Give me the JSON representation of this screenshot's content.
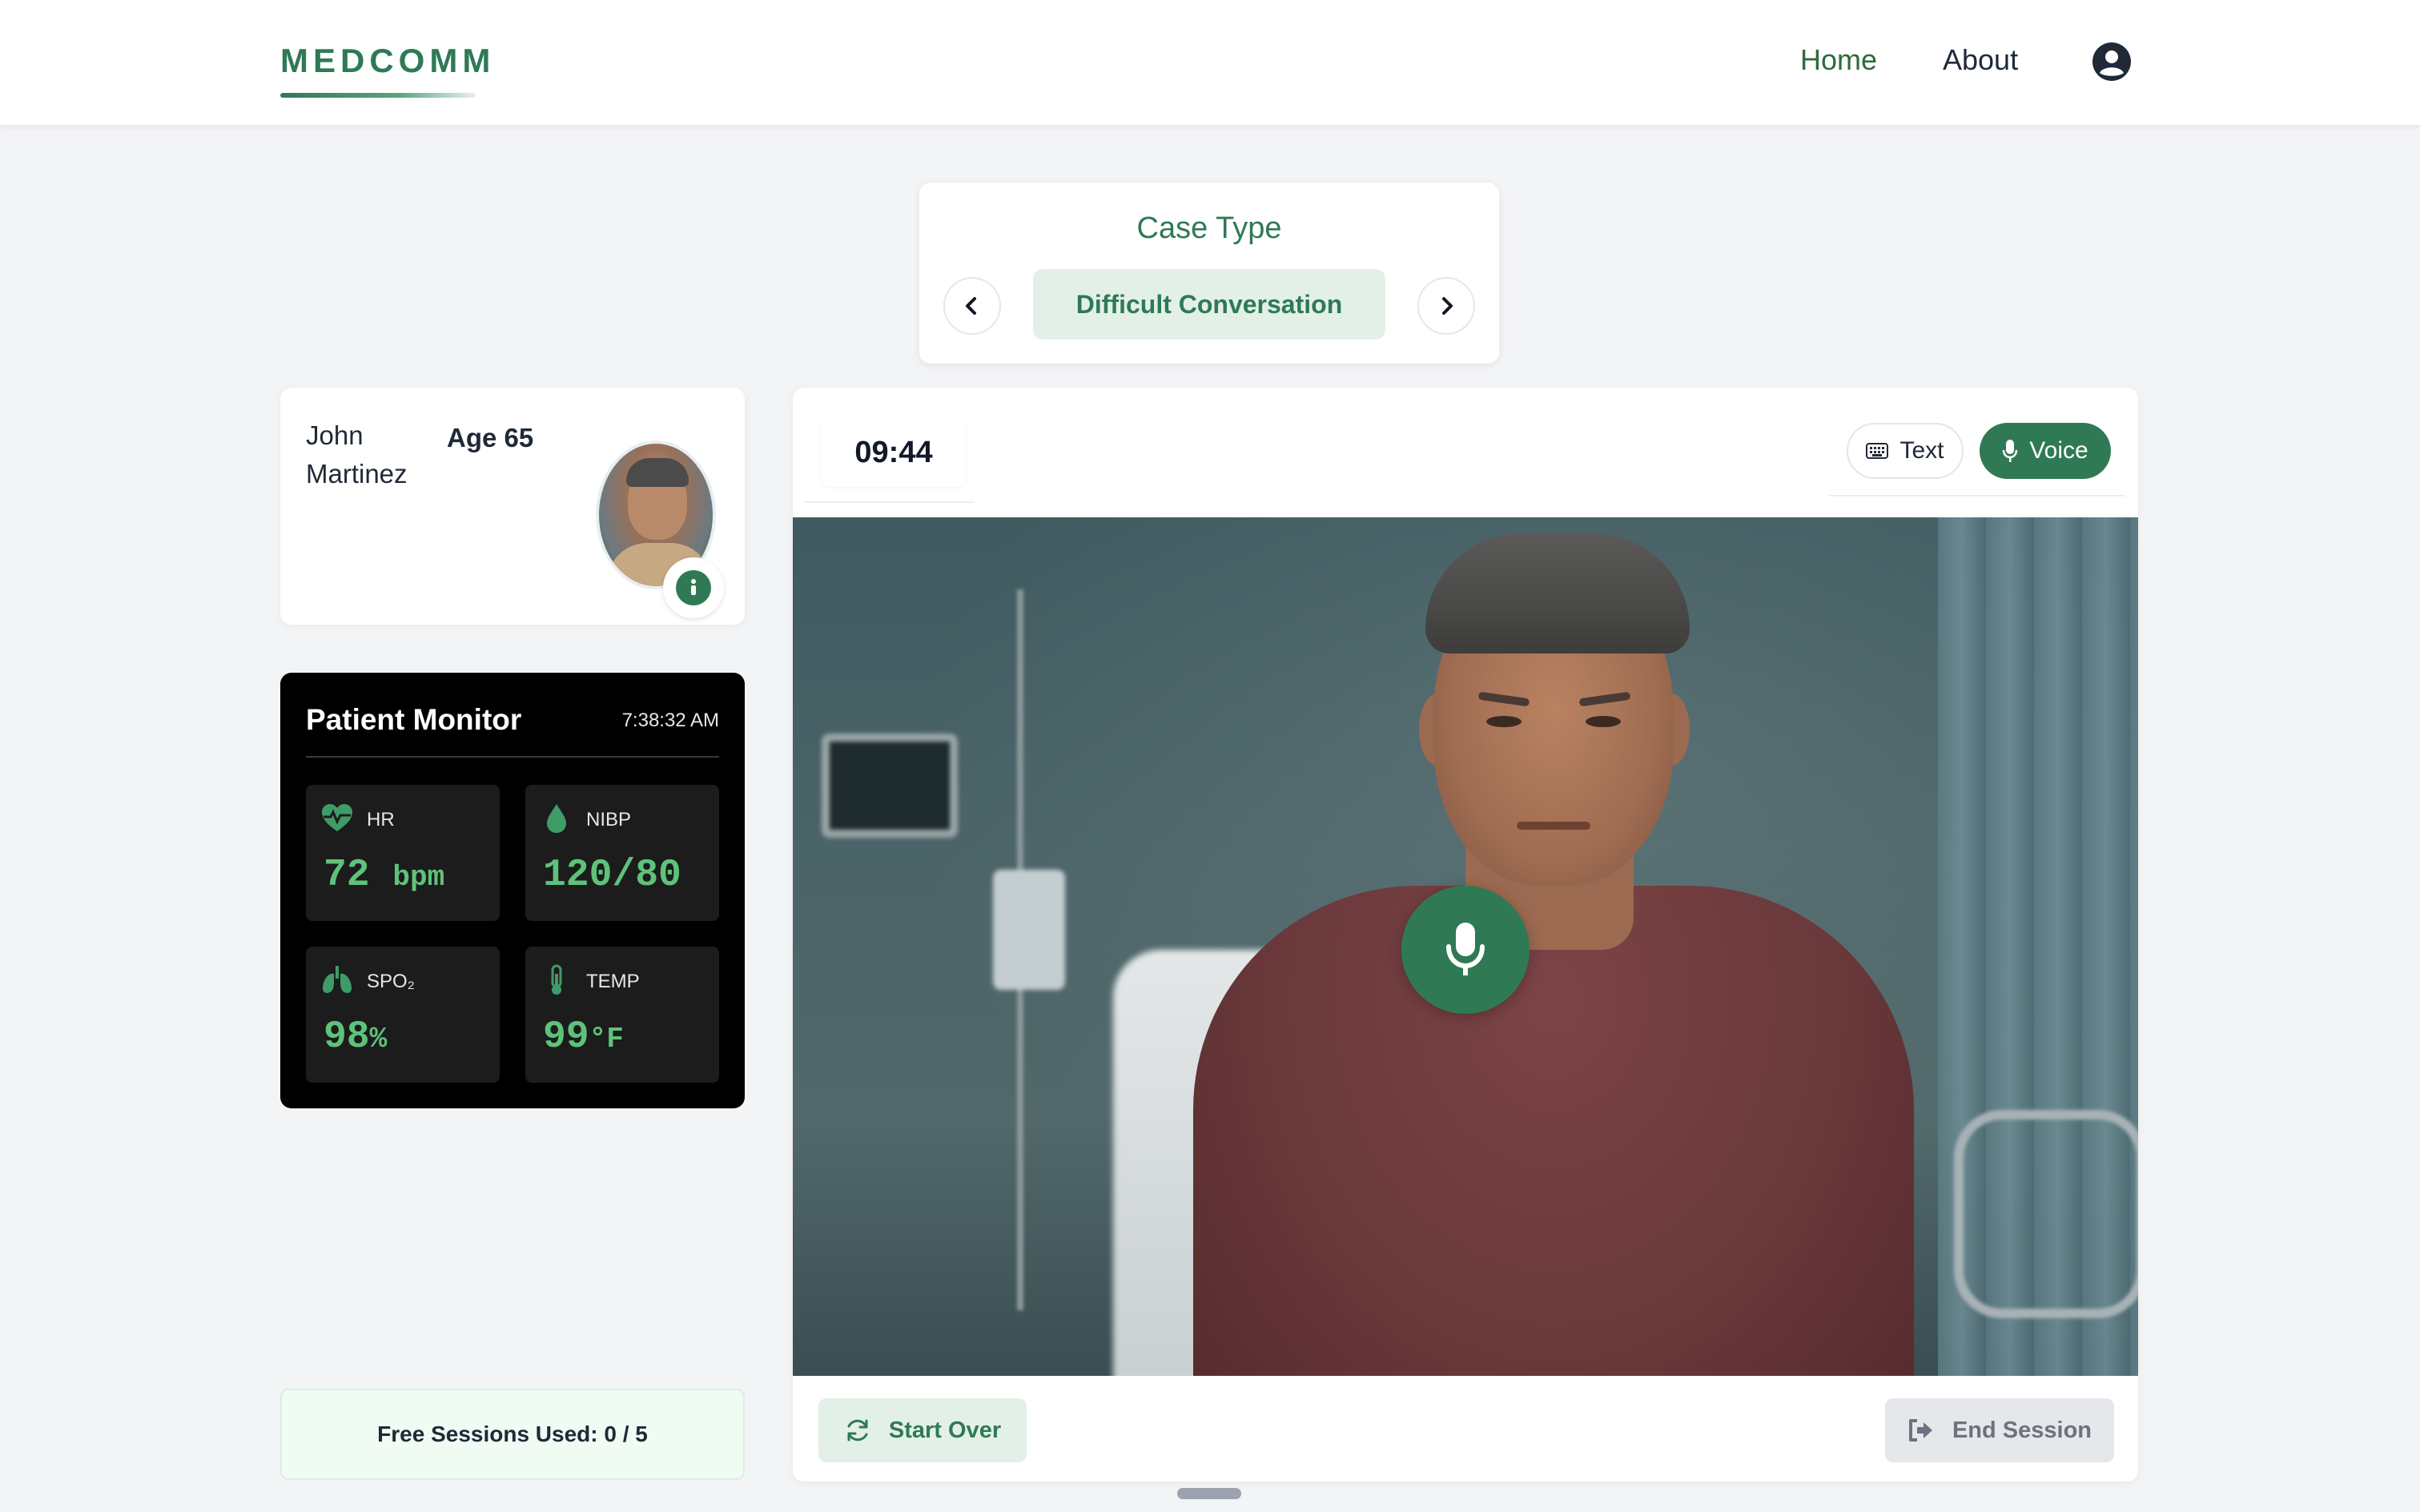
{
  "header": {
    "logo": "MEDCOMM",
    "nav": {
      "home": "Home",
      "about": "About"
    },
    "user_icon": "user-circle-icon"
  },
  "case_type": {
    "title": "Case Type",
    "selected": "Difficult Conversation",
    "prev_icon": "chevron-left-icon",
    "next_icon": "chevron-right-icon"
  },
  "patient": {
    "name": "John Martinez",
    "age": "Age 65",
    "info_icon": "info-icon"
  },
  "monitor": {
    "title": "Patient Monitor",
    "time": "7:38:32 AM",
    "vitals": [
      {
        "label": "HR",
        "value": "72",
        "unit": "bpm",
        "icon": "heart-pulse-icon"
      },
      {
        "label": "NIBP",
        "value": "120/80",
        "unit": "",
        "icon": "blood-drop-icon"
      },
      {
        "label": "SPO₂",
        "value": "98",
        "unit": "%",
        "icon": "lungs-icon"
      },
      {
        "label": "TEMP",
        "value": "99",
        "unit": "°F",
        "icon": "thermometer-icon"
      }
    ]
  },
  "sessions": {
    "text": "Free Sessions Used: 0 / 5"
  },
  "session": {
    "timer": "09:44",
    "mode_text": "Text",
    "mode_voice": "Voice",
    "active_mode": "Voice",
    "start_over": "Start Over",
    "end_session": "End Session"
  },
  "colors": {
    "brand": "#2f7a55",
    "vital_green": "#5ec27a",
    "monitor_bg": "#000000"
  }
}
